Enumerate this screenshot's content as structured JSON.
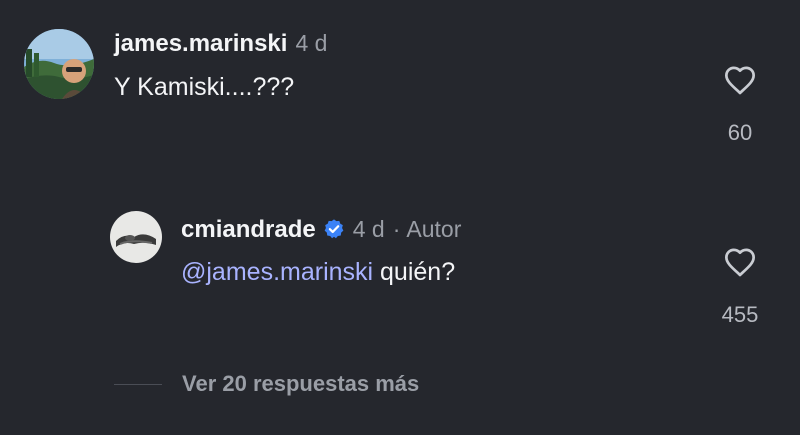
{
  "comments": [
    {
      "username": "james.marinski",
      "time": "4 d",
      "text": "Y Kamiski....???",
      "likes": "60"
    }
  ],
  "reply": {
    "username": "cmiandrade",
    "time": "4 d",
    "separator": "·",
    "author_label": "Autor",
    "mention": "@james.marinski",
    "text": " quién?",
    "likes": "455"
  },
  "view_more_replies": "Ver 20 respuestas más",
  "icons": {
    "like": "heart-outline-icon",
    "verified": "verified-badge-icon"
  },
  "colors": {
    "background": "#25272d",
    "mention": "#a9b3ff",
    "verified": "#3b82f6"
  }
}
